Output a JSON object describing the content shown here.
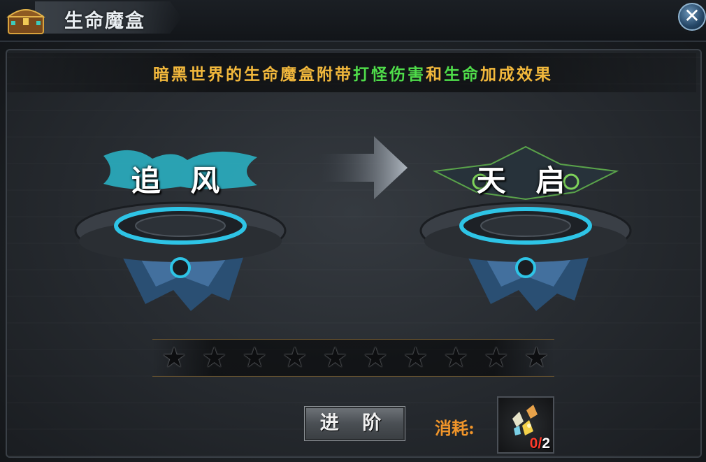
{
  "window": {
    "title": "生命魔盒",
    "close_symbol": "✕",
    "icons": {
      "title": "treasure-chest-icon",
      "close": "close-icon"
    }
  },
  "info": {
    "part1": "暗黑世界的生命魔盒附带",
    "part2": "打怪伤害",
    "part3": "和",
    "part4": "生命",
    "part5": "加成效果",
    "colors": {
      "normal": "#f2b83c",
      "highlight": "#4fdc4a"
    }
  },
  "current_rank": {
    "name": "追 风",
    "style": "cyan-wing"
  },
  "next_rank": {
    "name": "天 启",
    "style": "green-dark-wing"
  },
  "stars": {
    "total": 10,
    "filled": 0,
    "symbol": "★"
  },
  "advance": {
    "label": "进 阶"
  },
  "cost": {
    "label": "消耗:",
    "item_icon": "crystal-shards-icon",
    "have": "0",
    "separator": "/",
    "need": "2"
  }
}
